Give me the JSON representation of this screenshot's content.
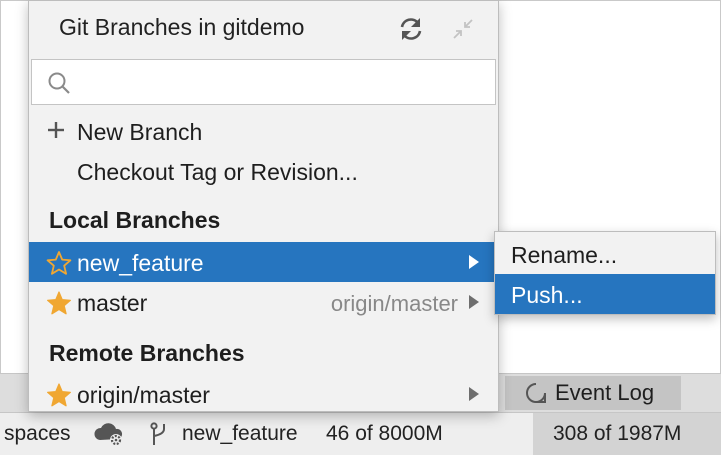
{
  "popup": {
    "title": "Git Branches in gitdemo",
    "search": {
      "value": "",
      "placeholder": ""
    },
    "actions": [
      {
        "label": "New Branch",
        "icon": "plus-icon"
      },
      {
        "label": "Checkout Tag or Revision..."
      }
    ],
    "local_header": "Local Branches",
    "local": [
      {
        "name": "new_feature",
        "selected": true,
        "icon": "star-outline-icon"
      },
      {
        "name": "master",
        "tracking": "origin/master",
        "icon": "star-filled-icon"
      }
    ],
    "remote_header": "Remote Branches",
    "remote": [
      {
        "name": "origin/master",
        "icon": "star-filled-icon"
      }
    ]
  },
  "submenu": {
    "items": [
      {
        "label": "Rename..."
      },
      {
        "label": "Push...",
        "selected": true
      }
    ]
  },
  "toolwindow": {
    "event_log": "Event Log"
  },
  "statusbar": {
    "spaces": "spaces",
    "branch": "new_feature",
    "memory1": "46 of 8000M",
    "memory2": "308 of 1987M"
  },
  "colors": {
    "selection": "#2675bf",
    "star": "#f0a732",
    "popup_bg": "#f2f2f2"
  }
}
